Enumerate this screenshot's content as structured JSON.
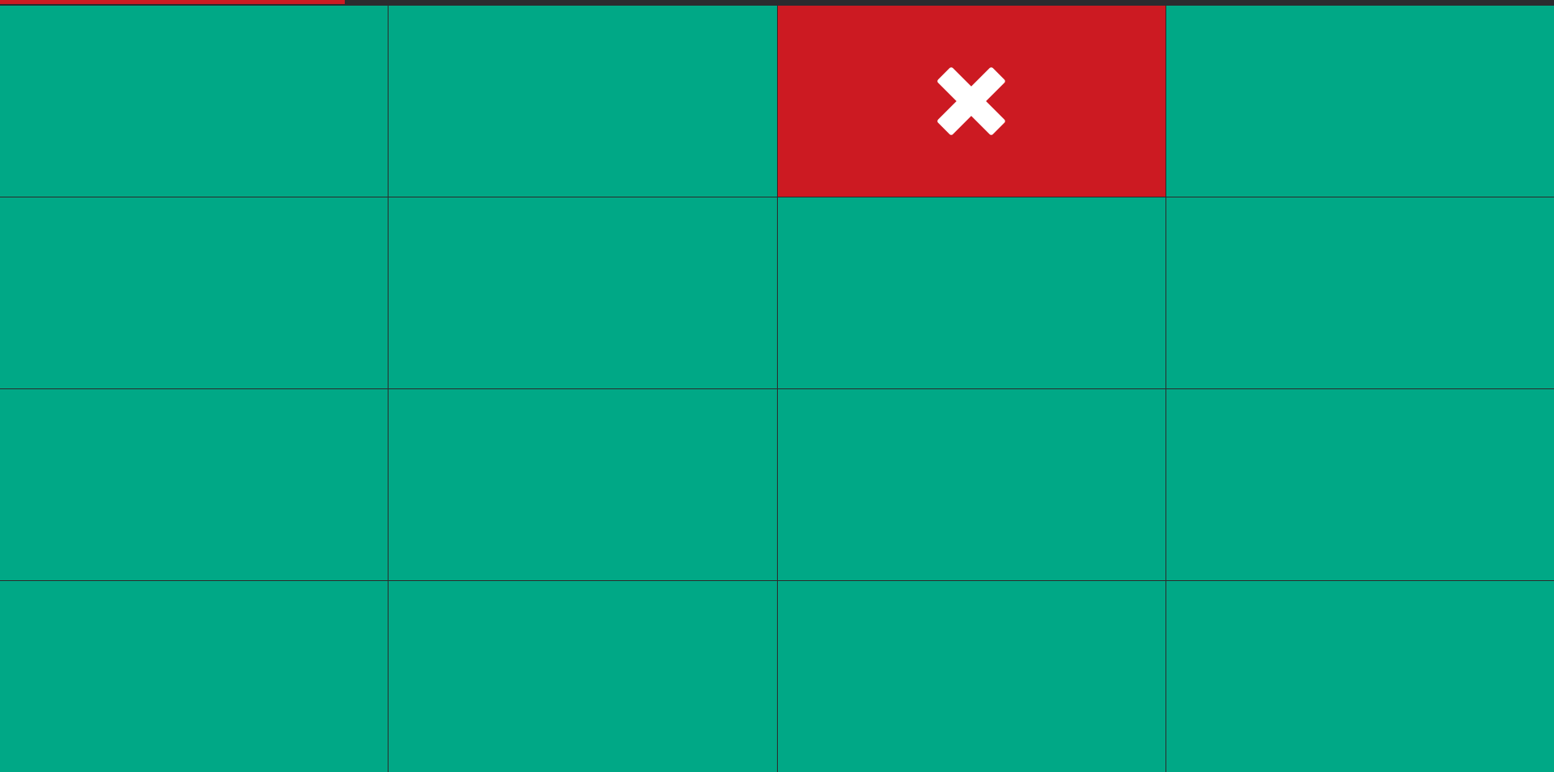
{
  "colors": {
    "tile_default": "#00a886",
    "tile_wrong": "#cc1a22",
    "grid_line": "#2c2c2c",
    "progress_track": "#2b2b2f",
    "progress_fill": "#cc1a22",
    "mark": "#ffffff"
  },
  "progress": {
    "fraction": 0.222
  },
  "board": {
    "rows": 4,
    "cols": 4,
    "tiles": [
      {
        "state": "default"
      },
      {
        "state": "default"
      },
      {
        "state": "wrong",
        "icon": "close-icon"
      },
      {
        "state": "default"
      },
      {
        "state": "default"
      },
      {
        "state": "default"
      },
      {
        "state": "default"
      },
      {
        "state": "default"
      },
      {
        "state": "default"
      },
      {
        "state": "default"
      },
      {
        "state": "default"
      },
      {
        "state": "default"
      },
      {
        "state": "default"
      },
      {
        "state": "default"
      },
      {
        "state": "default"
      },
      {
        "state": "default"
      }
    ]
  }
}
